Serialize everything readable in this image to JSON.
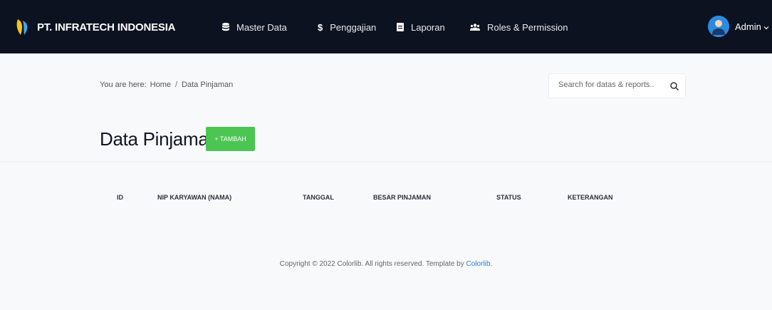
{
  "navbar": {
    "brand": "PT. INFRATECH INDONESIA",
    "items": [
      {
        "label": "Master Data",
        "icon": "database-icon"
      },
      {
        "label": "Penggajian",
        "icon": "dollar-icon"
      },
      {
        "label": "Laporan",
        "icon": "file-icon"
      },
      {
        "label": "Roles & Permission",
        "icon": "users-icon"
      }
    ],
    "user": "Admin"
  },
  "breadcrumb": {
    "prefix": "You are here:",
    "home": "Home",
    "separator": "/",
    "current": "Data Pinjaman"
  },
  "search": {
    "placeholder": "Search for datas & reports.."
  },
  "page": {
    "title": "Data Pinjaman",
    "add_button": "+ TAMBAH"
  },
  "table": {
    "columns": [
      "ID",
      "NIP KARYAWAN (NAMA)",
      "TANGGAL",
      "BESAR PINJAMAN",
      "STATUS",
      "KETERANGAN"
    ]
  },
  "footer": {
    "text": "Copyright © 2022 Colorlib. All rights reserved. Template by",
    "link": "Colorlib",
    "suffix": "."
  },
  "colors": {
    "navbar_bg": "#0d1220",
    "accent_green": "#4cc552",
    "link_blue": "#2a7de1"
  }
}
